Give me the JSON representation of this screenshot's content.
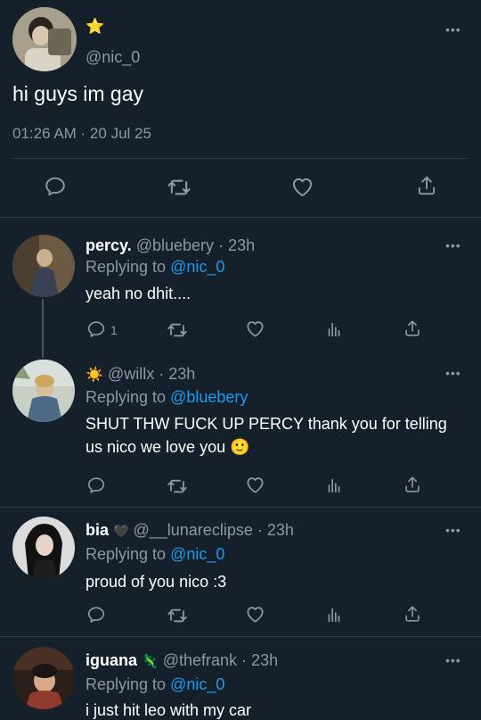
{
  "main_tweet": {
    "author_badge": "⭐",
    "handle": "@nic_0",
    "text": "hi guys im gay",
    "timestamp": "01:26 AM · 20 Jul 25",
    "more": "•••"
  },
  "replies": [
    {
      "name": "percy.",
      "handle": "@bluebery",
      "time": "· 23h",
      "replying_label": "Replying to",
      "replying_to": "@nic_0",
      "text": "yeah no dhit....",
      "reply_count": "1",
      "more": "•••"
    },
    {
      "name": "☀️",
      "handle": "@willx",
      "time": "· 23h",
      "replying_label": "Replying to",
      "replying_to": "@bluebery",
      "text_line1": "SHUT THW FUCK UP PERCY thank you for telling",
      "text_line2": "us nico we love you 🙂",
      "more": "•••"
    },
    {
      "name": "bia",
      "name_emoji": "🖤",
      "handle": "@__lunareclipse",
      "time": "· 23h",
      "replying_label": "Replying to",
      "replying_to": "@nic_0",
      "text": "proud of you nico :3",
      "more": "•••"
    },
    {
      "name": "iguana",
      "name_emoji": "🦎",
      "handle": "@thefrank",
      "time": "· 23h",
      "replying_label": "Replying to",
      "replying_to": "@nic_0",
      "text": "i just hit leo with my car",
      "more": "•••"
    }
  ],
  "colors": {
    "background": "#15202b",
    "muted": "#8b98a5",
    "link": "#1d9bf0",
    "divider": "#2f3a45"
  },
  "icons": {
    "reply": "speech-bubble-icon",
    "retweet": "retweet-icon",
    "like": "heart-icon",
    "views": "bar-chart-icon",
    "share": "share-icon"
  }
}
